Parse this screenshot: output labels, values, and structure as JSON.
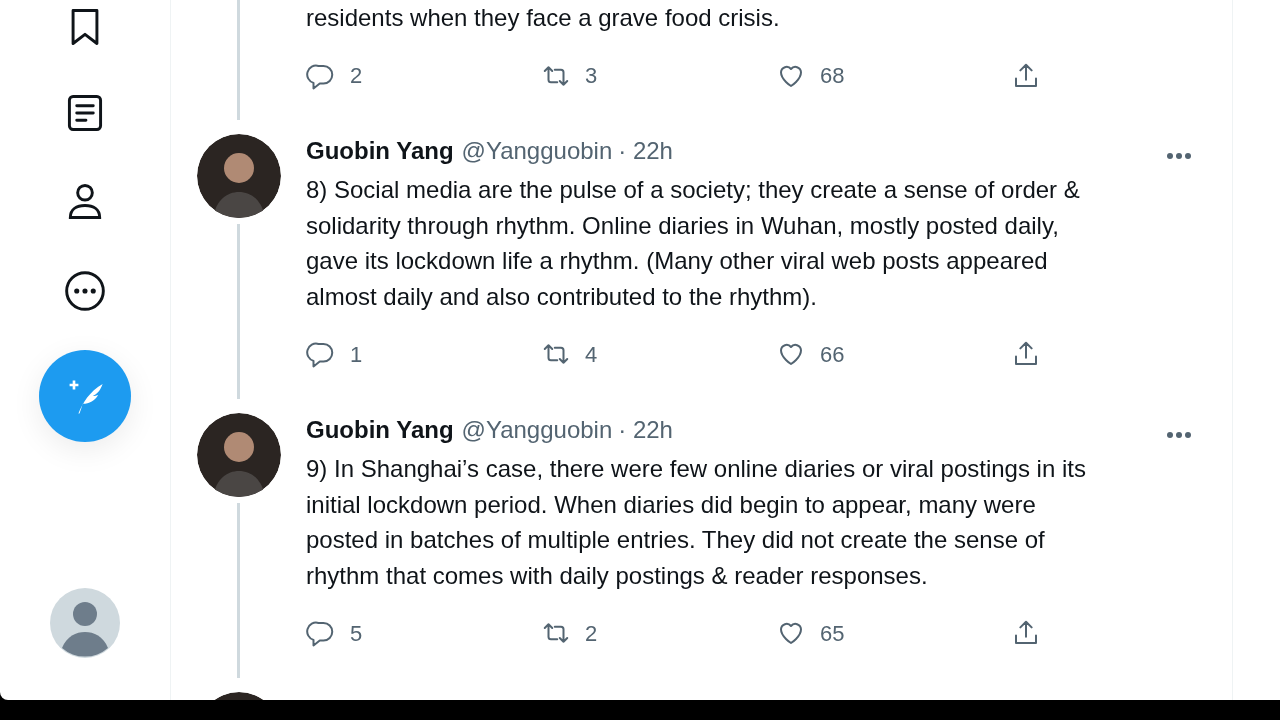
{
  "tweets": [
    {
      "kind": "tail",
      "text": "residents when they face a grave food crisis.",
      "replies": "2",
      "retweets": "3",
      "likes": "68"
    },
    {
      "kind": "full",
      "name": "Guobin Yang",
      "handle": "@Yangguobin",
      "time": "· 22h",
      "text": "8) Social media are the pulse of a society; they create a sense of order &\nsolidarity through rhythm. Online diaries in Wuhan, mostly posted daily,\ngave its lockdown life a rhythm. (Many other viral web posts appeared\nalmost daily and also contributed to the rhythm).",
      "replies": "1",
      "retweets": "4",
      "likes": "66"
    },
    {
      "kind": "full",
      "name": "Guobin Yang",
      "handle": "@Yangguobin",
      "time": "· 22h",
      "text": "9) In Shanghai’s case, there were few online diaries or viral postings in its\ninitial lockdown period. When diaries did begin to appear, many were\nposted in batches of multiple entries. They did not create the sense of\nrhythm that comes with daily postings & reader responses.",
      "replies": "5",
      "retweets": "2",
      "likes": "65"
    },
    {
      "kind": "cut"
    }
  ]
}
